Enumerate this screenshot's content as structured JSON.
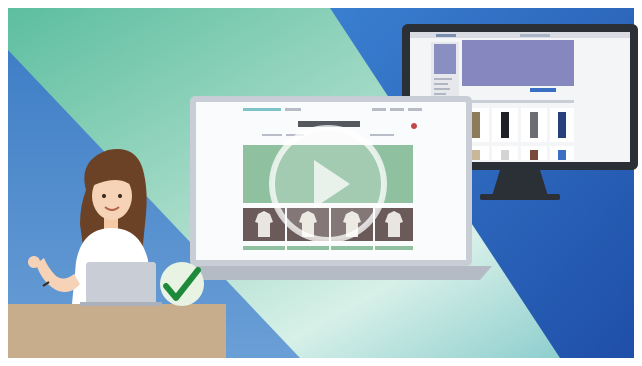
{
  "video": {
    "play_button_icon": "play-icon",
    "checkmark_icon": "checkmark-icon",
    "colors": {
      "background_blue": "#2f6fc4",
      "background_teal": "#6fc9b0",
      "desk": "#c7ad8c",
      "check_green": "#1c8a3a",
      "hair": "#6b4226",
      "laptop_silver": "#c9ced6",
      "banner_green": "#8fc0a0",
      "banner_purple": "#8787c0"
    }
  }
}
